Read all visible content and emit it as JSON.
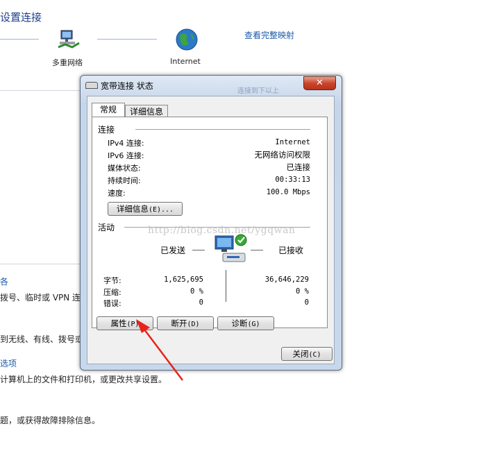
{
  "background": {
    "title": "设置连接",
    "view_full_map": "查看完整映射",
    "multi_network_label": "多重网络",
    "internet_label": "Internet",
    "left_fragments": [
      {
        "text": "各",
        "style": "blue"
      },
      {
        "text": "拨号、临时或 VPN 连接",
        "style": "text"
      },
      {
        "text": "到无线、有线、拨号或",
        "style": "text"
      },
      {
        "text": "选项",
        "style": "blue"
      },
      {
        "text": "计算机上的文件和打印机，或更改共享设置。",
        "style": "text"
      },
      {
        "text": "题，或获得故障排除信息。",
        "style": "text"
      }
    ]
  },
  "dialog": {
    "title": "宽带连接 状态",
    "title_faint": "连接到下以上",
    "close_symbol": "✕",
    "tabs": [
      {
        "label": "常规",
        "active": true
      },
      {
        "label": "详细信息",
        "active": false
      }
    ],
    "connection": {
      "group_label": "连接",
      "rows": [
        {
          "label": "IPv4 连接:",
          "value": "Internet"
        },
        {
          "label": "IPv6 连接:",
          "value": "无网络访问权限"
        },
        {
          "label": "媒体状态:",
          "value": "已连接"
        },
        {
          "label": "持续时间:",
          "value": "00:33:13"
        },
        {
          "label": "速度:",
          "value": "100.0 Mbps"
        }
      ],
      "details_button": {
        "text": "详细信息",
        "mnemonic": "(E)..."
      }
    },
    "activity": {
      "group_label": "活动",
      "sent_label": "已发送",
      "received_label": "已接收",
      "rows": [
        {
          "label": "字节:",
          "sent": "1,625,695",
          "received": "36,646,229"
        },
        {
          "label": "压缩:",
          "sent": "0 %",
          "received": "0 %"
        },
        {
          "label": "错误:",
          "sent": "0",
          "received": "0"
        }
      ]
    },
    "buttons": {
      "properties": {
        "text": "属性",
        "mnemonic": "(P)"
      },
      "disable": {
        "text": "断开",
        "mnemonic": "(D)"
      },
      "diagnose": {
        "text": "诊断",
        "mnemonic": "(G)"
      },
      "close": {
        "text": "关闭",
        "mnemonic": "(C)"
      }
    },
    "watermark": "http://blog.csdn.net/ygqwan"
  },
  "annotation_arrow_color": "#e8231a"
}
